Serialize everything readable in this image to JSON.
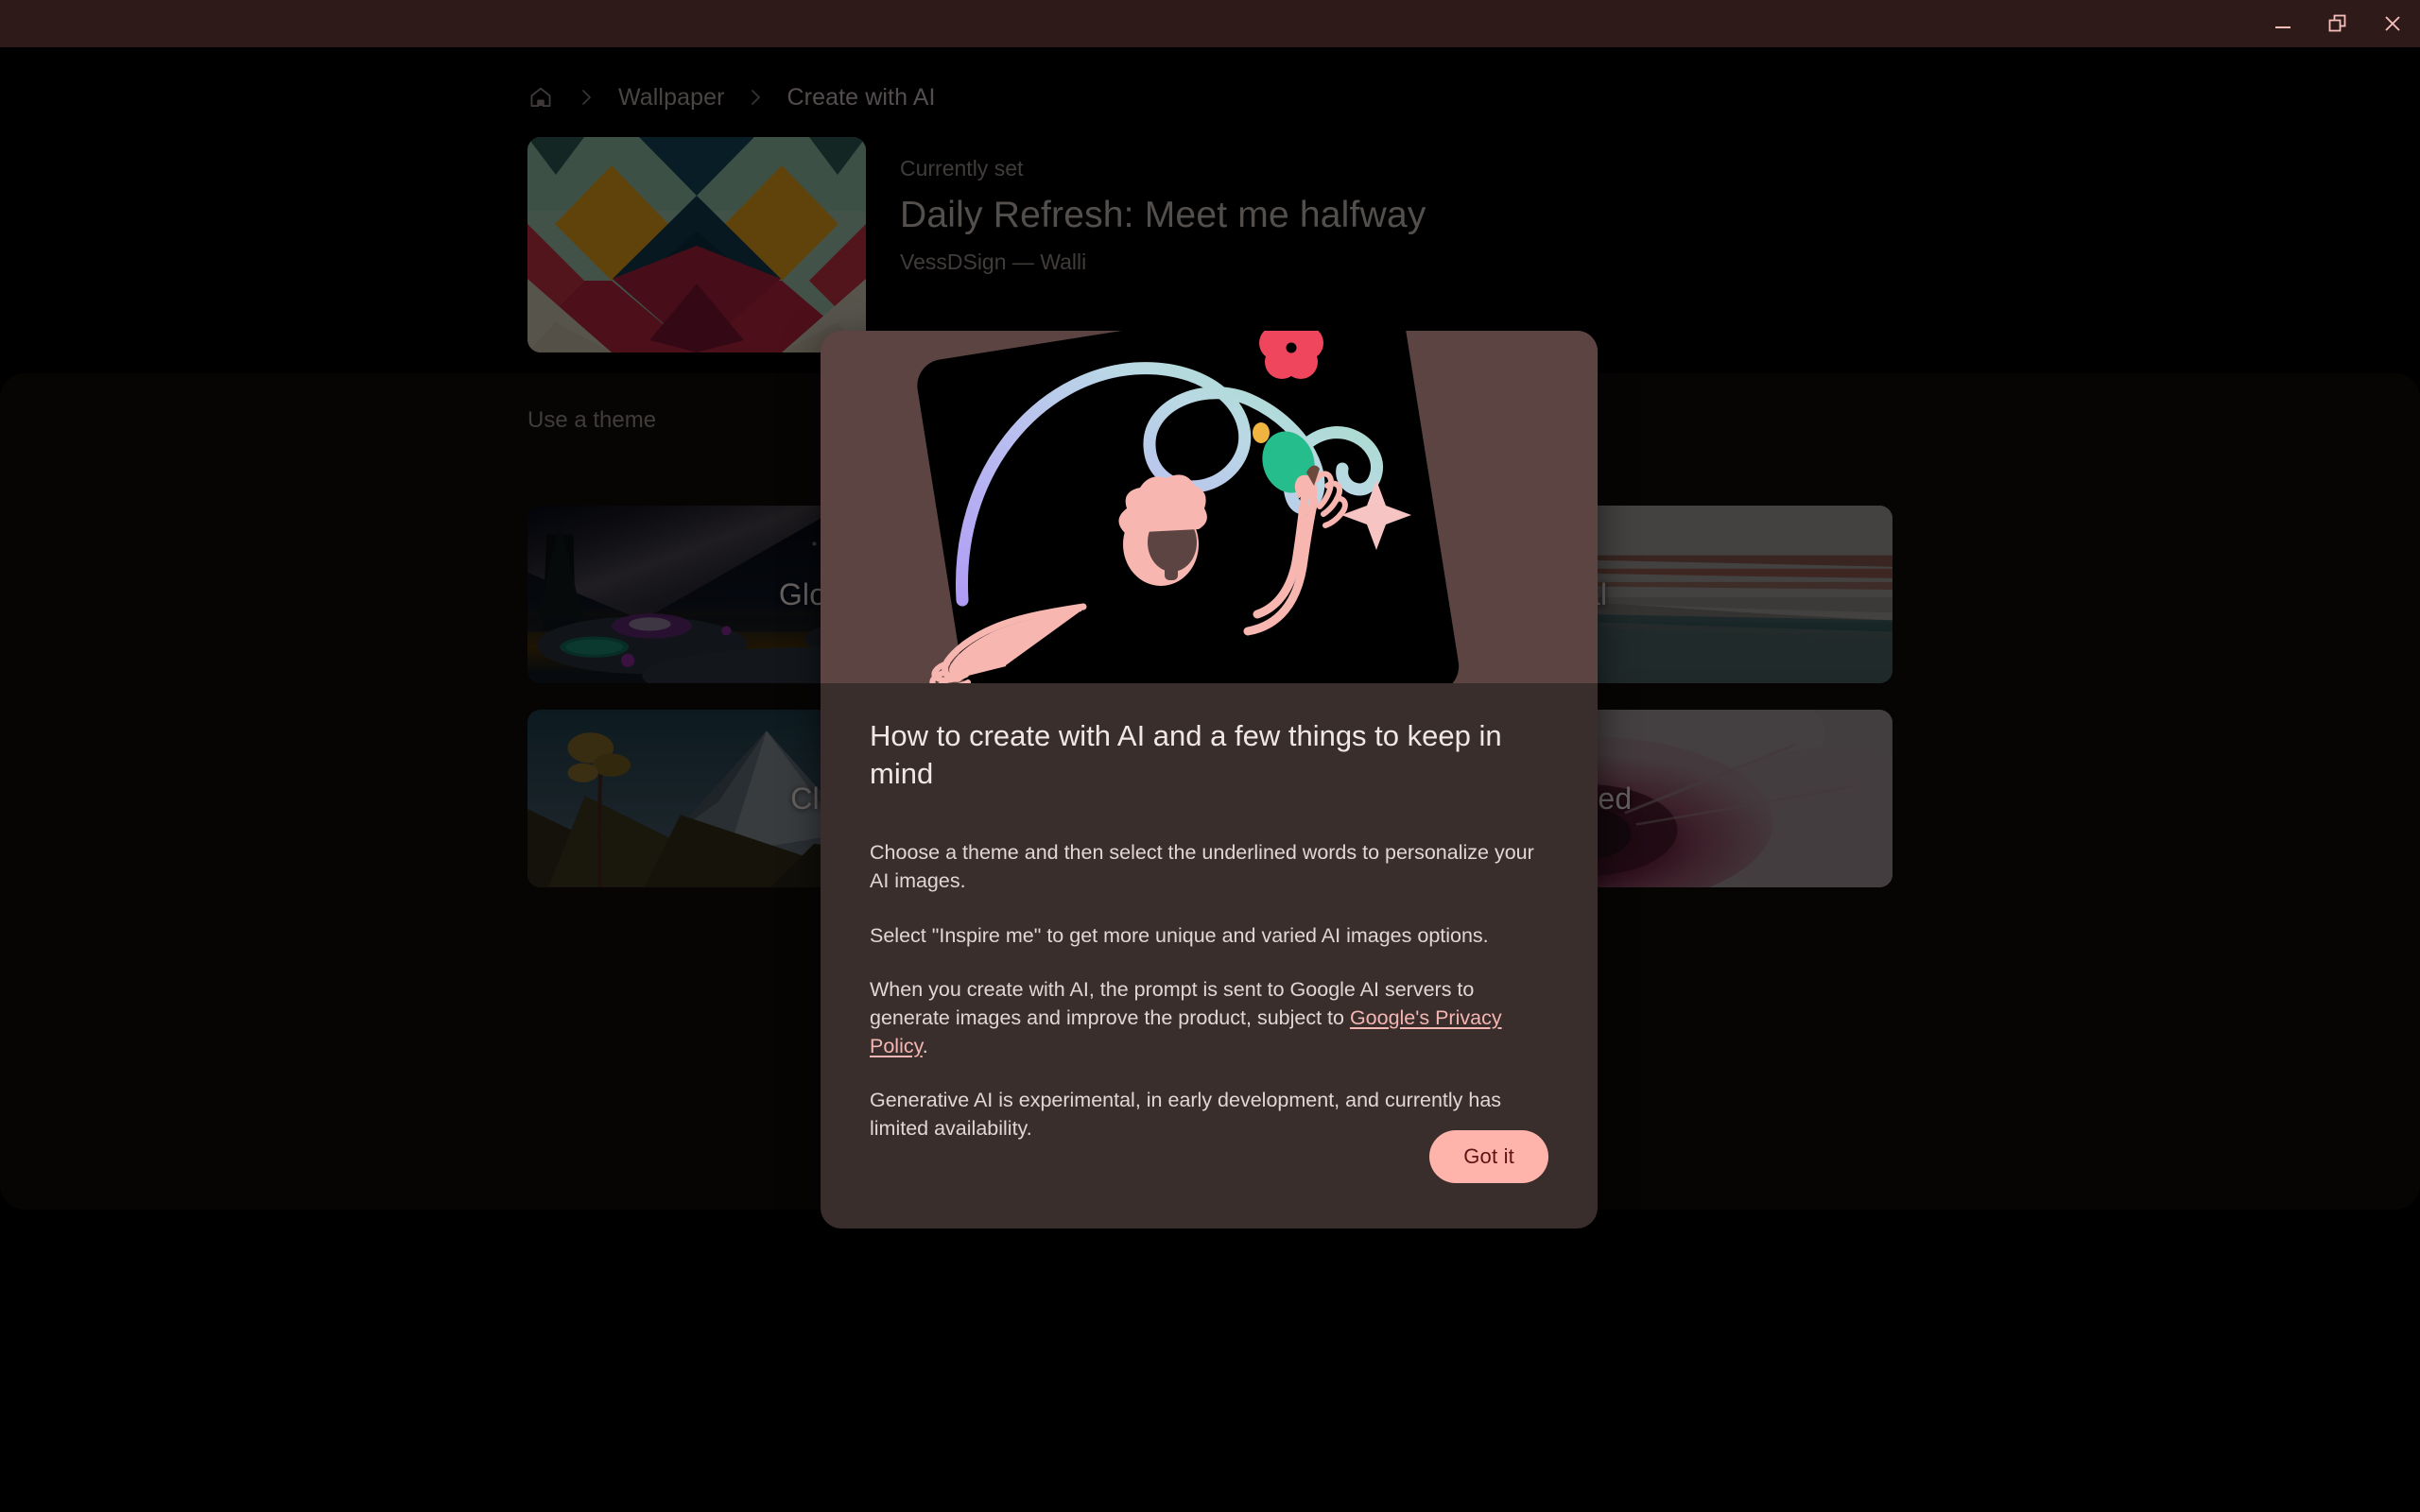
{
  "window": {
    "controls": [
      {
        "name": "minimize-button",
        "icon": "minimize-icon",
        "label": "Minimize"
      },
      {
        "name": "restore-button",
        "icon": "restore-window-icon",
        "label": "Restore"
      },
      {
        "name": "close-button",
        "icon": "close-icon",
        "label": "Close"
      }
    ],
    "titlebar_color": "#2e1a19",
    "control_color": "#f6bfbc"
  },
  "breadcrumb": {
    "home_icon": "home-icon",
    "separator": "›",
    "items": [
      {
        "label": "Wallpaper",
        "current": false
      },
      {
        "label": "Create with AI",
        "current": true
      }
    ]
  },
  "current_wallpaper": {
    "eyebrow": "Currently set",
    "title": "Daily Refresh: Meet me halfway",
    "author": "VessDSign — Walli",
    "thumbnail_alt": "geometric-diamond-wallpaper"
  },
  "themes": {
    "section_title": "Use a theme",
    "cards": [
      {
        "label": "Glowscapes",
        "art": "glowscapes"
      },
      {
        "label": "Surreal",
        "art": "surreal"
      },
      {
        "label": "Classic art",
        "art": "classic-art"
      },
      {
        "label": "Airbrushed",
        "art": "airbrushed"
      }
    ]
  },
  "dialog": {
    "illustration_alt": "person-drawing-gradient-swirl-illustration",
    "title": "How to create with AI and a few things to keep in mind",
    "paragraph_1": "Choose a theme and then select the underlined words to personalize your AI images.",
    "paragraph_2": "Select \"Inspire me\" to get more unique and varied AI images options.",
    "paragraph_3_before": "When you create with AI, the prompt is sent to Google AI servers to generate images and improve the product, subject to ",
    "paragraph_3_link": "Google's Privacy Policy",
    "paragraph_3_after": ".",
    "paragraph_4": "Generative AI is experimental, in early development, and currently has limited availability.",
    "primary_button": "Got it",
    "surface_color": "#3a2e2c",
    "hero_color": "#5c4443",
    "button_color": "#ffb4ab",
    "button_text_color": "#5c1513",
    "link_color": "#f3b6b2"
  }
}
